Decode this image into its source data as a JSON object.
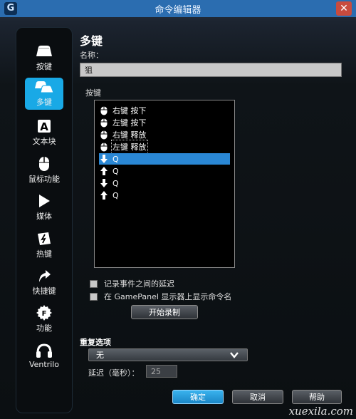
{
  "window": {
    "title": "命令编辑器",
    "close": "✕",
    "logo": "G"
  },
  "sidebar": {
    "items": [
      {
        "label": "按键",
        "icon": "keycap-icon"
      },
      {
        "label": "多键",
        "icon": "multikey-icon"
      },
      {
        "label": "文本块",
        "icon": "text-block-icon"
      },
      {
        "label": "鼠标功能",
        "icon": "mouse-icon"
      },
      {
        "label": "媒体",
        "icon": "play-icon"
      },
      {
        "label": "热键",
        "icon": "hotkey-icon"
      },
      {
        "label": "快捷键",
        "icon": "shortcut-arrow-icon"
      },
      {
        "label": "功能",
        "icon": "function-icon"
      },
      {
        "label": "Ventrilo",
        "icon": "headset-icon"
      }
    ]
  },
  "main": {
    "title": "多键",
    "name_label": "名称：",
    "name_value": "狙",
    "keys_label": "按键",
    "keys": [
      {
        "text": "右键 按下",
        "icon": "mouse"
      },
      {
        "text": "左键 按下",
        "icon": "mouse"
      },
      {
        "text": "右键 释放",
        "icon": "mouse"
      },
      {
        "text": "左键 释放",
        "icon": "mouse"
      },
      {
        "text": "Q",
        "icon": "down"
      },
      {
        "text": "Q",
        "icon": "up"
      },
      {
        "text": "Q",
        "icon": "down"
      },
      {
        "text": "Q",
        "icon": "up"
      }
    ],
    "check_delay": "记录事件之间的延迟",
    "check_gamepanel": "在 GamePanel 显示器上显示命令名",
    "record_button": "开始录制",
    "repeat_label": "重复选项",
    "repeat_value": "无",
    "delay_label": "延迟（毫秒）：",
    "delay_value": "25"
  },
  "footer": {
    "ok": "确定",
    "cancel": "取消",
    "help": "帮助"
  },
  "watermark": "xuexila.com",
  "colors": {
    "accent": "#19a9e6",
    "titlebar": "#2b6db0",
    "selection": "#2a87d4",
    "close": "#c94b3e"
  }
}
